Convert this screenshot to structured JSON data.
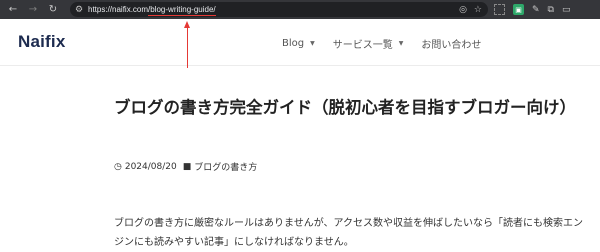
{
  "browser": {
    "url_host": "https://naifix.com",
    "url_path": "/blog-writing-guide/",
    "icons": {
      "back": "arrow-left-icon",
      "forward": "arrow-right-icon",
      "reload": "reload-icon",
      "site_info": "tune-icon",
      "eye_off": "eye-off-icon",
      "star": "star-icon",
      "extensions": "puzzle-icon"
    }
  },
  "site": {
    "logo": "Naifix",
    "nav": [
      {
        "label": "Blog"
      },
      {
        "label": "サービス一覧"
      },
      {
        "label": "お問い合わせ"
      }
    ]
  },
  "article": {
    "title": "ブログの書き方完全ガイド（脱初心者を目指すブロガー向け）",
    "date": "2024/08/20",
    "category": "ブログの書き方",
    "body": "ブログの書き方に厳密なルールはありませんが、アクセス数や収益を伸ばしたいなら「読者にも検索エンジンにも読みやすい記事」にしなければなりません。"
  },
  "colors": {
    "toolbar_bg": "#35363a",
    "omnibox_bg": "#202124",
    "annotation_red": "#e53935",
    "logo_navy": "#1d2b4f",
    "extension_green": "#2ea86a"
  }
}
